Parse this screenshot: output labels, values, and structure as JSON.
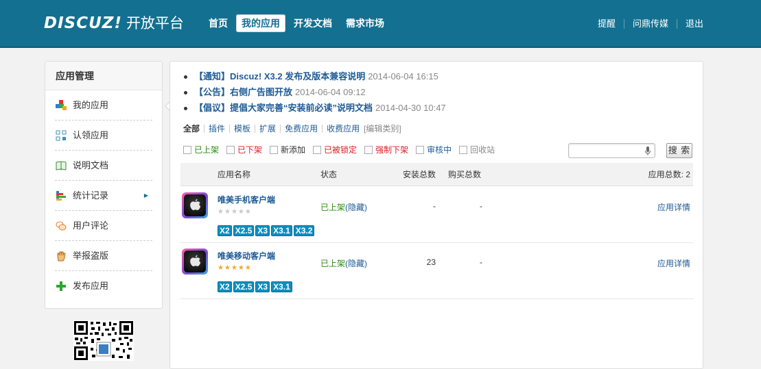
{
  "header": {
    "logo_brand": "DISCUZ!",
    "logo_sub": "开放平台",
    "nav": [
      {
        "label": "首页",
        "active": false
      },
      {
        "label": "我的应用",
        "active": true
      },
      {
        "label": "开发文档",
        "active": false
      },
      {
        "label": "需求市场",
        "active": false
      }
    ],
    "user_links": [
      "提醒",
      "问鼎传媒",
      "退出"
    ]
  },
  "sidebar": {
    "title": "应用管理",
    "items": [
      {
        "label": "我的应用",
        "icon": "app-blocks-icon"
      },
      {
        "label": "认领应用",
        "icon": "claim-grid-icon"
      },
      {
        "label": "说明文档",
        "icon": "book-icon"
      },
      {
        "label": "统计记录",
        "icon": "stats-bars-icon",
        "has_arrow": true
      },
      {
        "label": "用户评论",
        "icon": "comment-bubbles-icon"
      },
      {
        "label": "举报盗版",
        "icon": "hand-icon"
      },
      {
        "label": "发布应用",
        "icon": "green-plus-icon"
      }
    ],
    "qr_icon": "qr-code-icon"
  },
  "notices": [
    {
      "text": "【通知】Discuz! X3.2 发布及版本兼容说明",
      "date": "2014-06-04 16:15"
    },
    {
      "text": "【公告】右侧广告图开放",
      "date": "2014-06-04 09:12"
    },
    {
      "text": "【倡议】提倡大家完善“安装前必读”说明文档",
      "date": "2014-04-30 10:47"
    }
  ],
  "filters": {
    "categories": [
      "全部",
      "插件",
      "模板",
      "扩展",
      "免费应用",
      "收费应用"
    ],
    "edit_label": "[编辑类别]"
  },
  "status_filters": [
    {
      "label": "已上架",
      "color": "#2a8a10"
    },
    {
      "label": "已下架",
      "color": "#d81e1e"
    },
    {
      "label": "新添加",
      "color": "#333333"
    },
    {
      "label": "已被锁定",
      "color": "#d81e1e"
    },
    {
      "label": "强制下架",
      "color": "#d81e1e"
    },
    {
      "label": "审核中",
      "color": "#1e5a94"
    },
    {
      "label": "回收站",
      "color": "#888888"
    }
  ],
  "search": {
    "value": "",
    "button_label": "搜 索"
  },
  "table": {
    "headers": {
      "name": "应用名称",
      "status": "状态",
      "install": "安装总数",
      "buy": "购买总数",
      "total": "应用总数: 2"
    },
    "rows": [
      {
        "name": "唯美手机客户端",
        "stars": 0,
        "versions": [
          "X2",
          "X2.5",
          "X3",
          "X3.1",
          "X3.2"
        ],
        "status": "已上架",
        "status_extra": "(隐藏)",
        "install": "-",
        "buy": "-",
        "detail": "应用详情"
      },
      {
        "name": "唯美移动客户端",
        "stars": 5,
        "versions": [
          "X2",
          "X2.5",
          "X3",
          "X3.1"
        ],
        "status": "已上架",
        "status_extra": "(隐藏)",
        "install": "23",
        "buy": "-",
        "detail": "应用详情"
      }
    ]
  },
  "colors": {
    "header_bg": "#137090",
    "link": "#1e5a94",
    "badge": "#0c8ec0"
  }
}
